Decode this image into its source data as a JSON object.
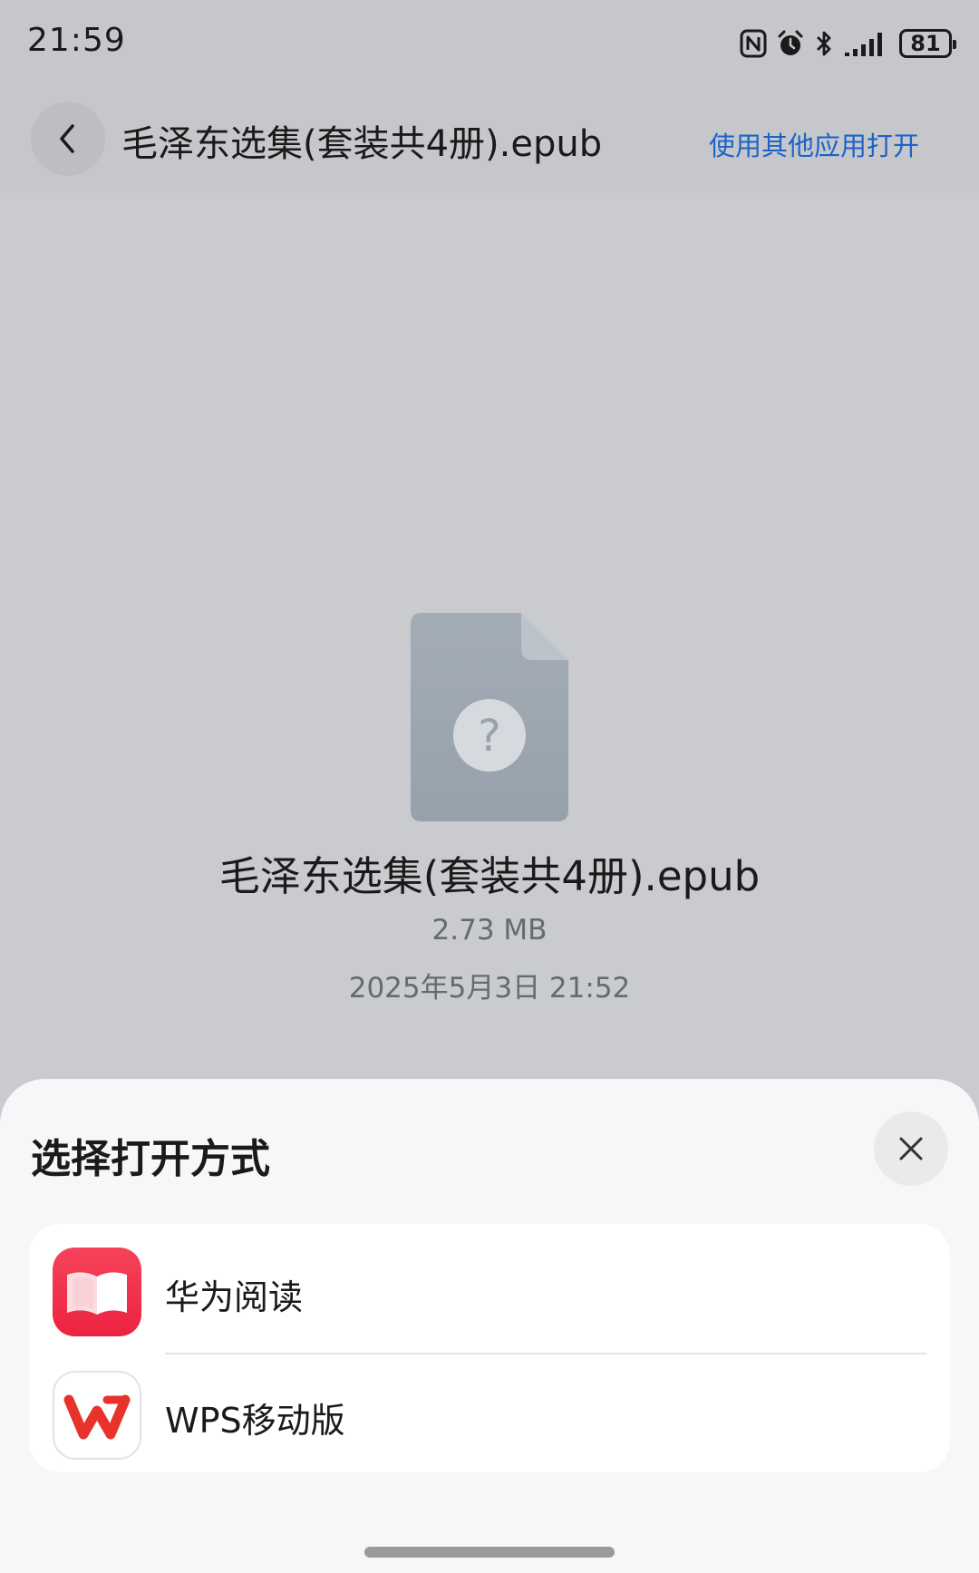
{
  "status_bar": {
    "time": "21:59",
    "battery": "81",
    "icons": [
      "nfc-icon",
      "alarm-icon",
      "bluetooth-icon",
      "signal-icon",
      "battery-icon"
    ]
  },
  "header": {
    "title": "毛泽东选集(套装共4册).epub",
    "open_other_label": "使用其他应用打开",
    "accent_color": "#1d62c9"
  },
  "file": {
    "name": "毛泽东选集(套装共4册).epub",
    "size": "2.73 MB",
    "date": "2025年5月3日 21:52",
    "icon": "unknown-file-icon"
  },
  "sheet": {
    "title": "选择打开方式",
    "apps": [
      {
        "label": "华为阅读",
        "icon": "huawei-books-icon",
        "color": "#f2334a"
      },
      {
        "label": "WPS移动版",
        "icon": "wps-icon",
        "color": "#e8332c"
      }
    ]
  }
}
